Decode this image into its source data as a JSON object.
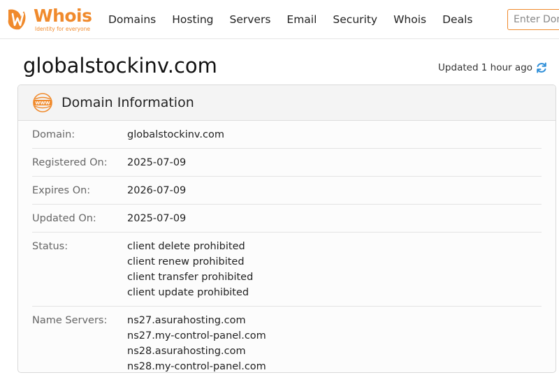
{
  "header": {
    "logo_text": "Whois",
    "logo_tagline": "Identity for everyone",
    "nav": [
      {
        "label": "Domains"
      },
      {
        "label": "Hosting"
      },
      {
        "label": "Servers"
      },
      {
        "label": "Email"
      },
      {
        "label": "Security"
      },
      {
        "label": "Whois"
      },
      {
        "label": "Deals"
      }
    ],
    "search_placeholder": "Enter Domain"
  },
  "page": {
    "title": "globalstockinv.com",
    "updated_text": "Updated 1 hour ago"
  },
  "card": {
    "title": "Domain Information",
    "icon_label": "WWW",
    "rows": [
      {
        "label": "Domain:",
        "values": [
          "globalstockinv.com"
        ]
      },
      {
        "label": "Registered On:",
        "values": [
          "2025-07-09"
        ]
      },
      {
        "label": "Expires On:",
        "values": [
          "2026-07-09"
        ]
      },
      {
        "label": "Updated On:",
        "values": [
          "2025-07-09"
        ]
      },
      {
        "label": "Status:",
        "values": [
          "client delete prohibited",
          "client renew prohibited",
          "client transfer prohibited",
          "client update prohibited"
        ]
      },
      {
        "label": "Name Servers:",
        "values": [
          "ns27.asurahosting.com",
          "ns27.my-control-panel.com",
          "ns28.asurahosting.com",
          "ns28.my-control-panel.com"
        ]
      }
    ]
  },
  "colors": {
    "brand": "#f08a2c",
    "refresh": "#2f8fd8"
  }
}
